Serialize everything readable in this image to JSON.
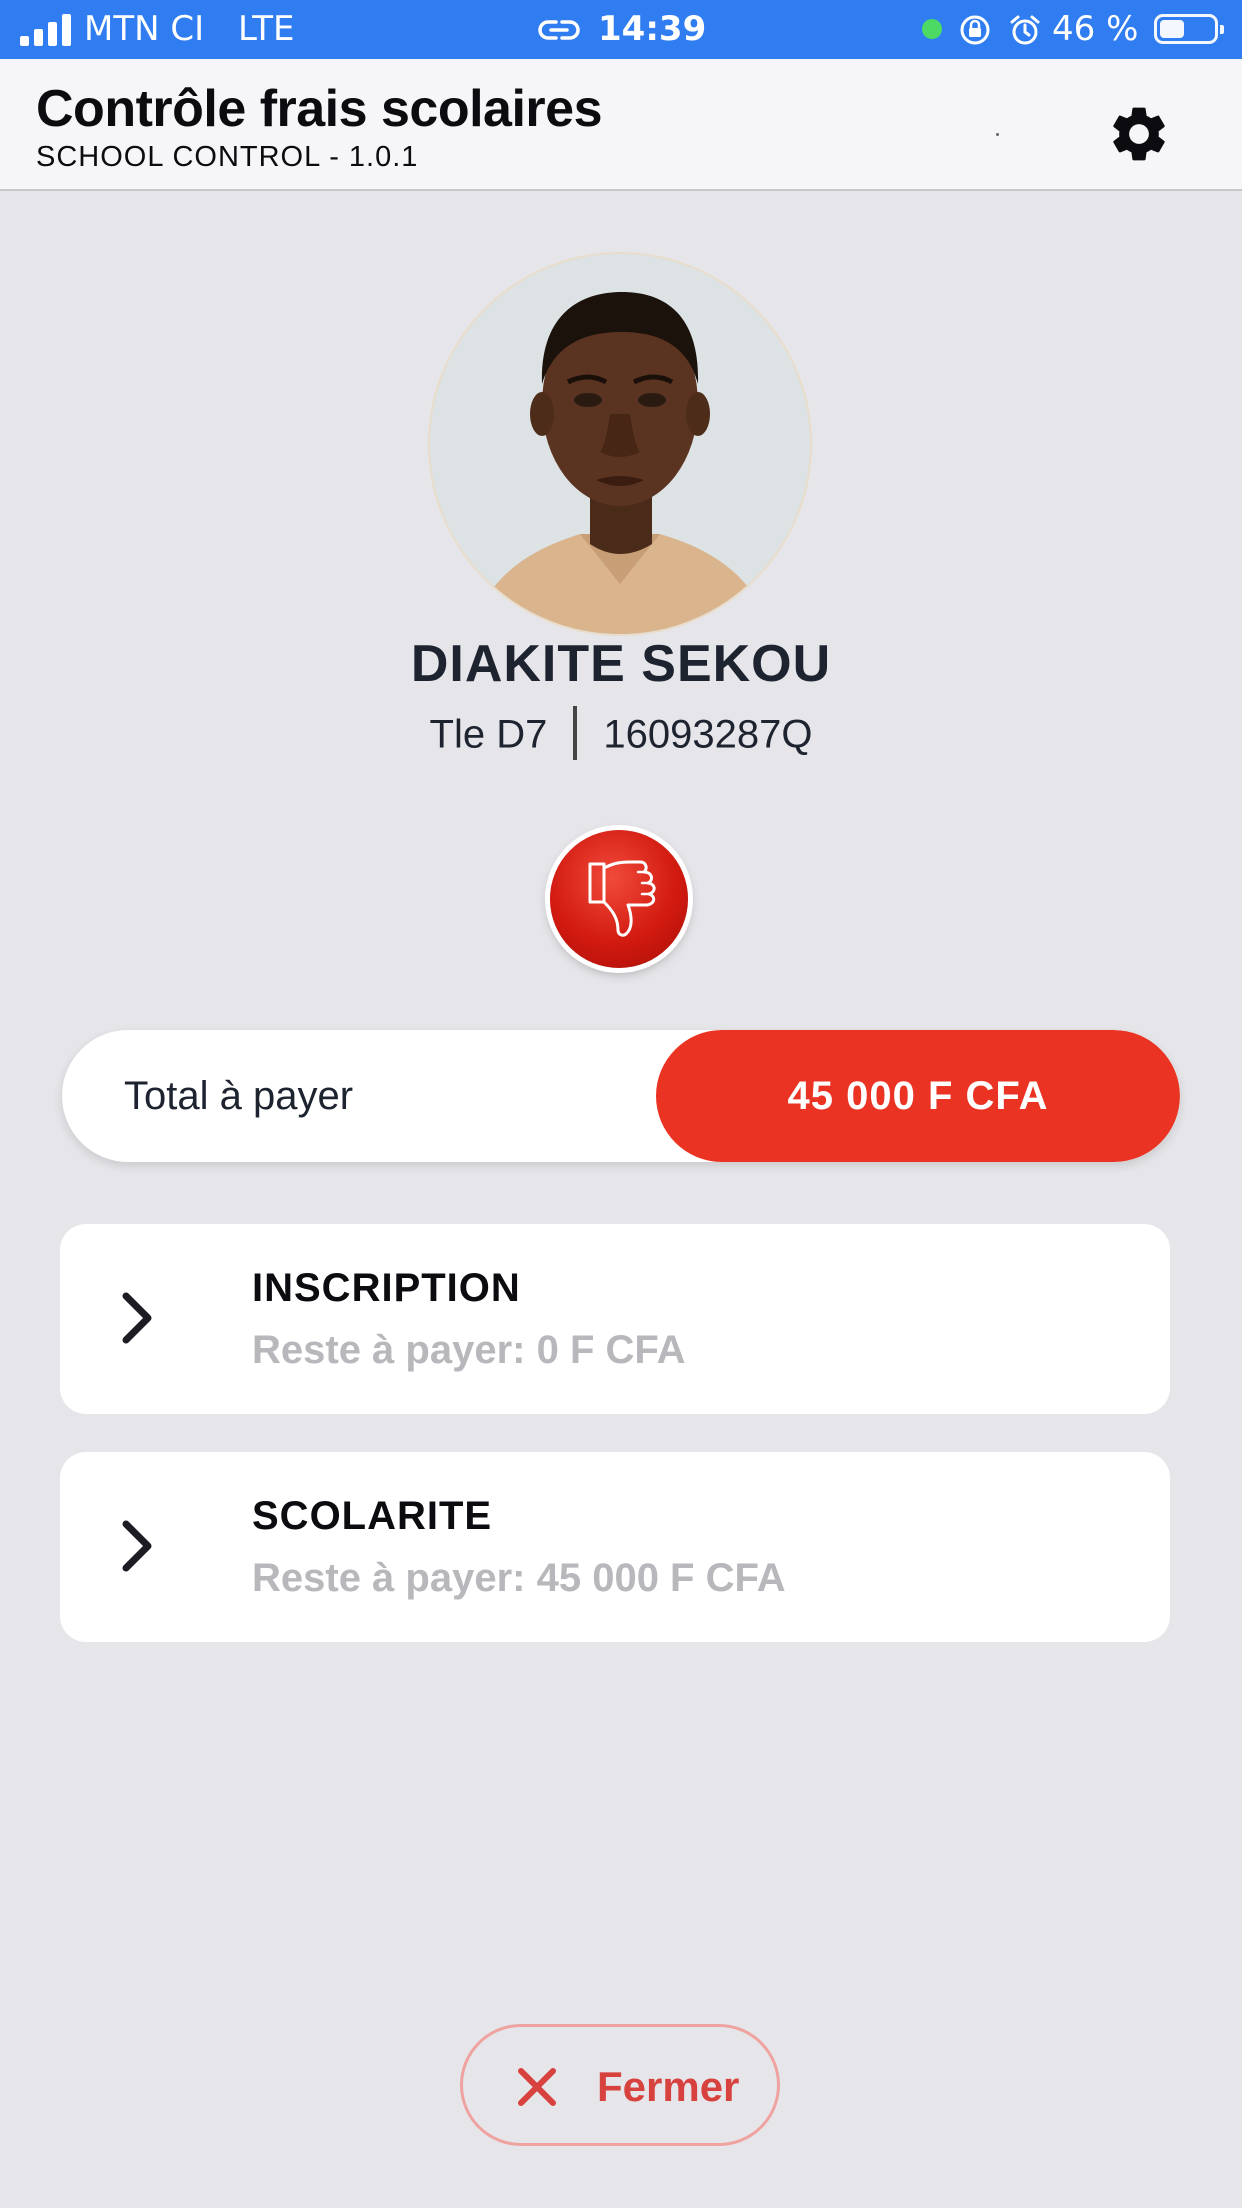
{
  "status_bar": {
    "carrier": "MTN CI",
    "network": "LTE",
    "time": "14:39",
    "battery": "46 %",
    "battery_level": 0.46
  },
  "header": {
    "title": "Contrôle frais scolaires",
    "subtitle": "SCHOOL CONTROL - 1.0.1",
    "settings_icon": "gear-icon"
  },
  "student": {
    "name": "DIAKITE SEKOU",
    "class": "Tle D7",
    "id": "16093287Q",
    "status_icon": "thumbs-down-icon"
  },
  "total": {
    "label": "Total à payer",
    "amount": "45 000 F CFA"
  },
  "fees": [
    {
      "title": "INSCRIPTION",
      "remaining": "Reste à payer: 0 F CFA"
    },
    {
      "title": "SCOLARITE",
      "remaining": "Reste à payer: 45 000 F CFA"
    }
  ],
  "close_button": {
    "label": "Fermer"
  },
  "colors": {
    "status_bar": "#2f7df0",
    "accent_red": "#ea3323",
    "background": "#e6e6ea",
    "muted_text": "#b7b7bc"
  }
}
